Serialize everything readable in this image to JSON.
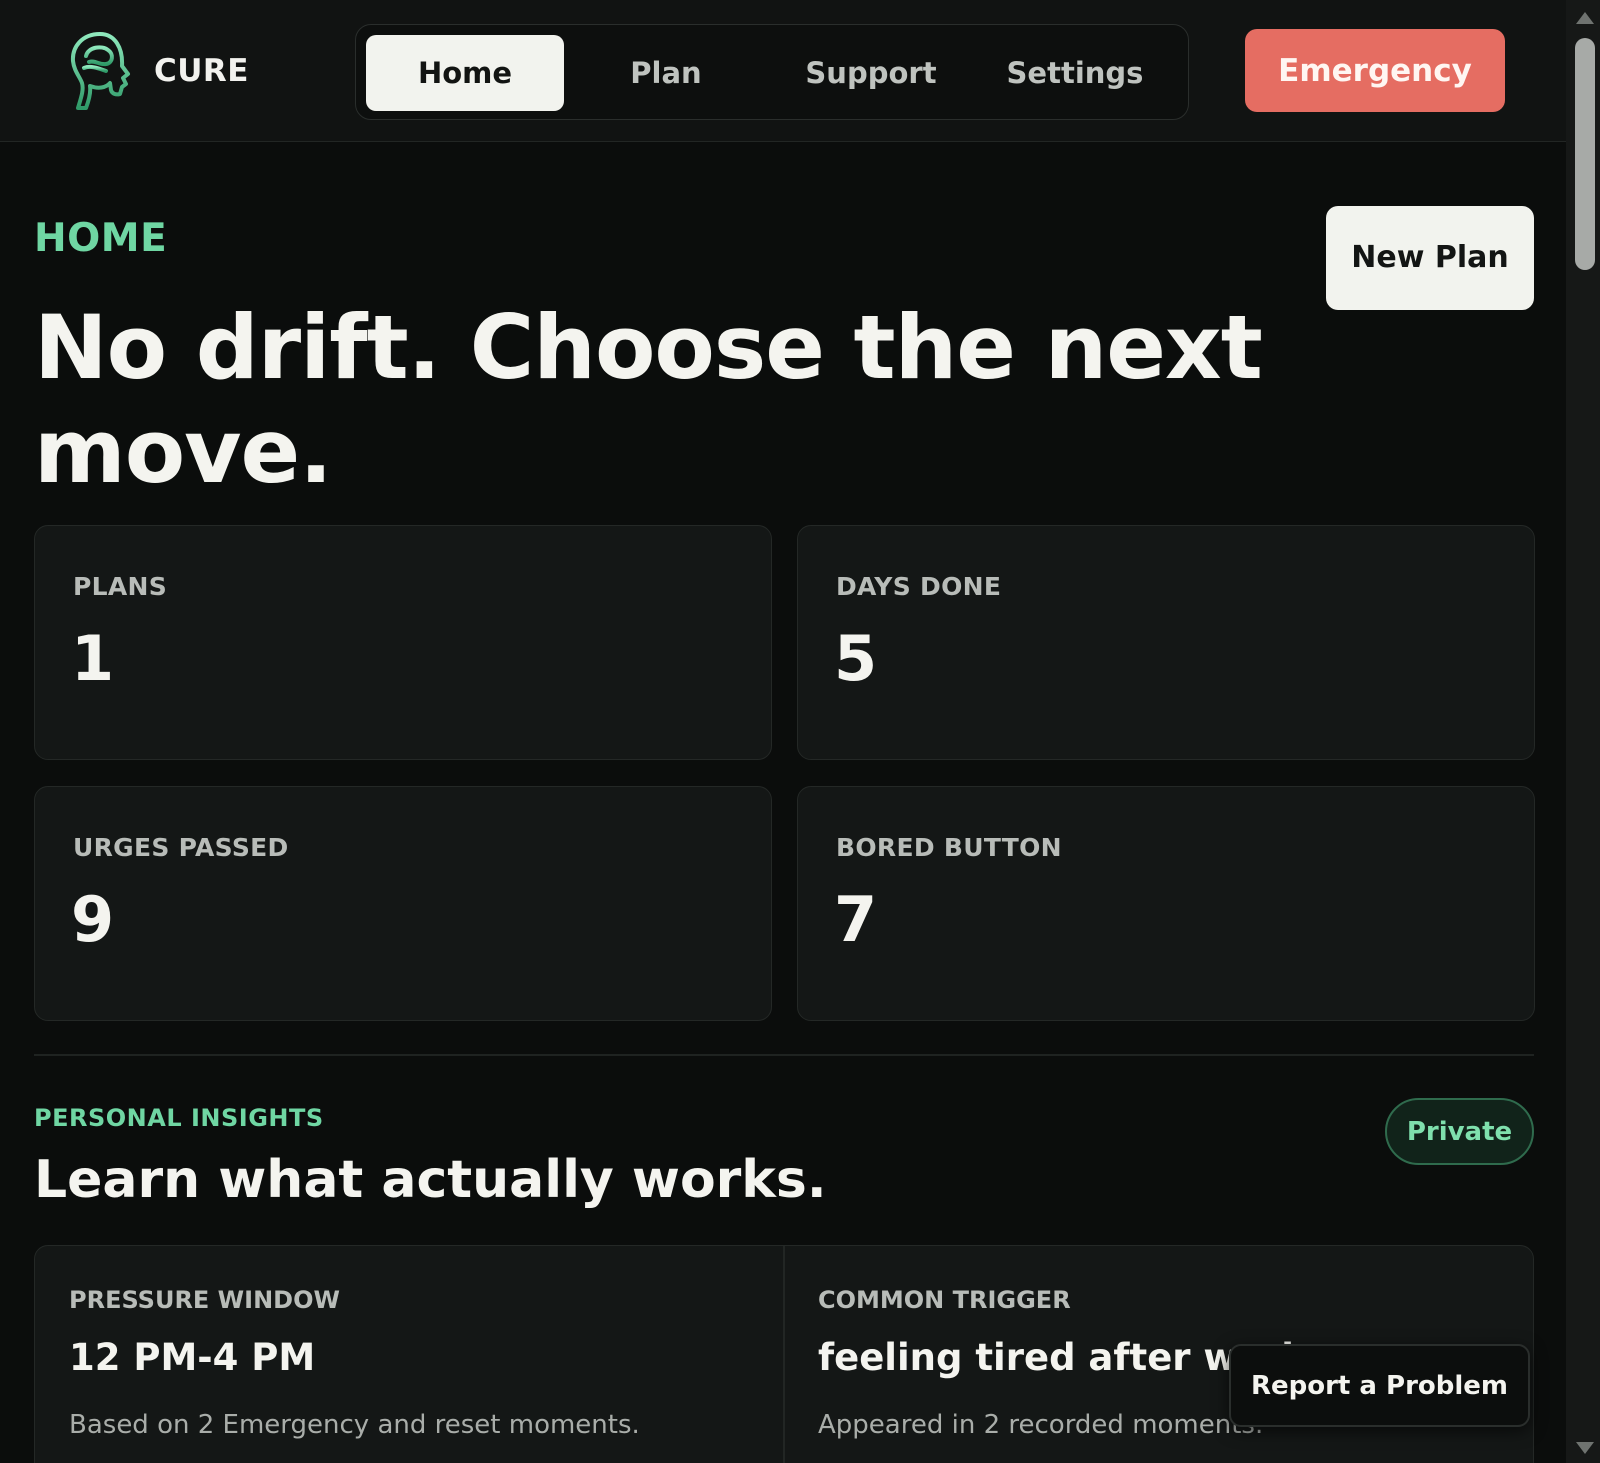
{
  "app": {
    "name": "CURE",
    "accent_color": "#6fd6a3",
    "emergency_color": "#e56d62"
  },
  "nav": {
    "items": [
      {
        "label": "Home",
        "active": true
      },
      {
        "label": "Plan",
        "active": false
      },
      {
        "label": "Support",
        "active": false
      },
      {
        "label": "Settings",
        "active": false
      }
    ],
    "emergency_label": "Emergency"
  },
  "home": {
    "eyebrow": "HOME",
    "title": "No drift. Choose the next move.",
    "new_plan_label": "New Plan"
  },
  "stats": [
    {
      "label": "PLANS",
      "value": "1"
    },
    {
      "label": "DAYS DONE",
      "value": "5"
    },
    {
      "label": "URGES PASSED",
      "value": "9"
    },
    {
      "label": "BORED BUTTON",
      "value": "7"
    }
  ],
  "insights": {
    "eyebrow": "PERSONAL INSIGHTS",
    "title": "Learn what actually works.",
    "badge": "Private",
    "cards": [
      {
        "label": "PRESSURE WINDOW",
        "value": "12 PM-4 PM",
        "note": "Based on 2 Emergency and reset moments."
      },
      {
        "label": "COMMON TRIGGER",
        "value": "feeling tired after work",
        "note": "Appeared in 2 recorded moments."
      }
    ]
  },
  "report_problem_label": "Report a Problem"
}
